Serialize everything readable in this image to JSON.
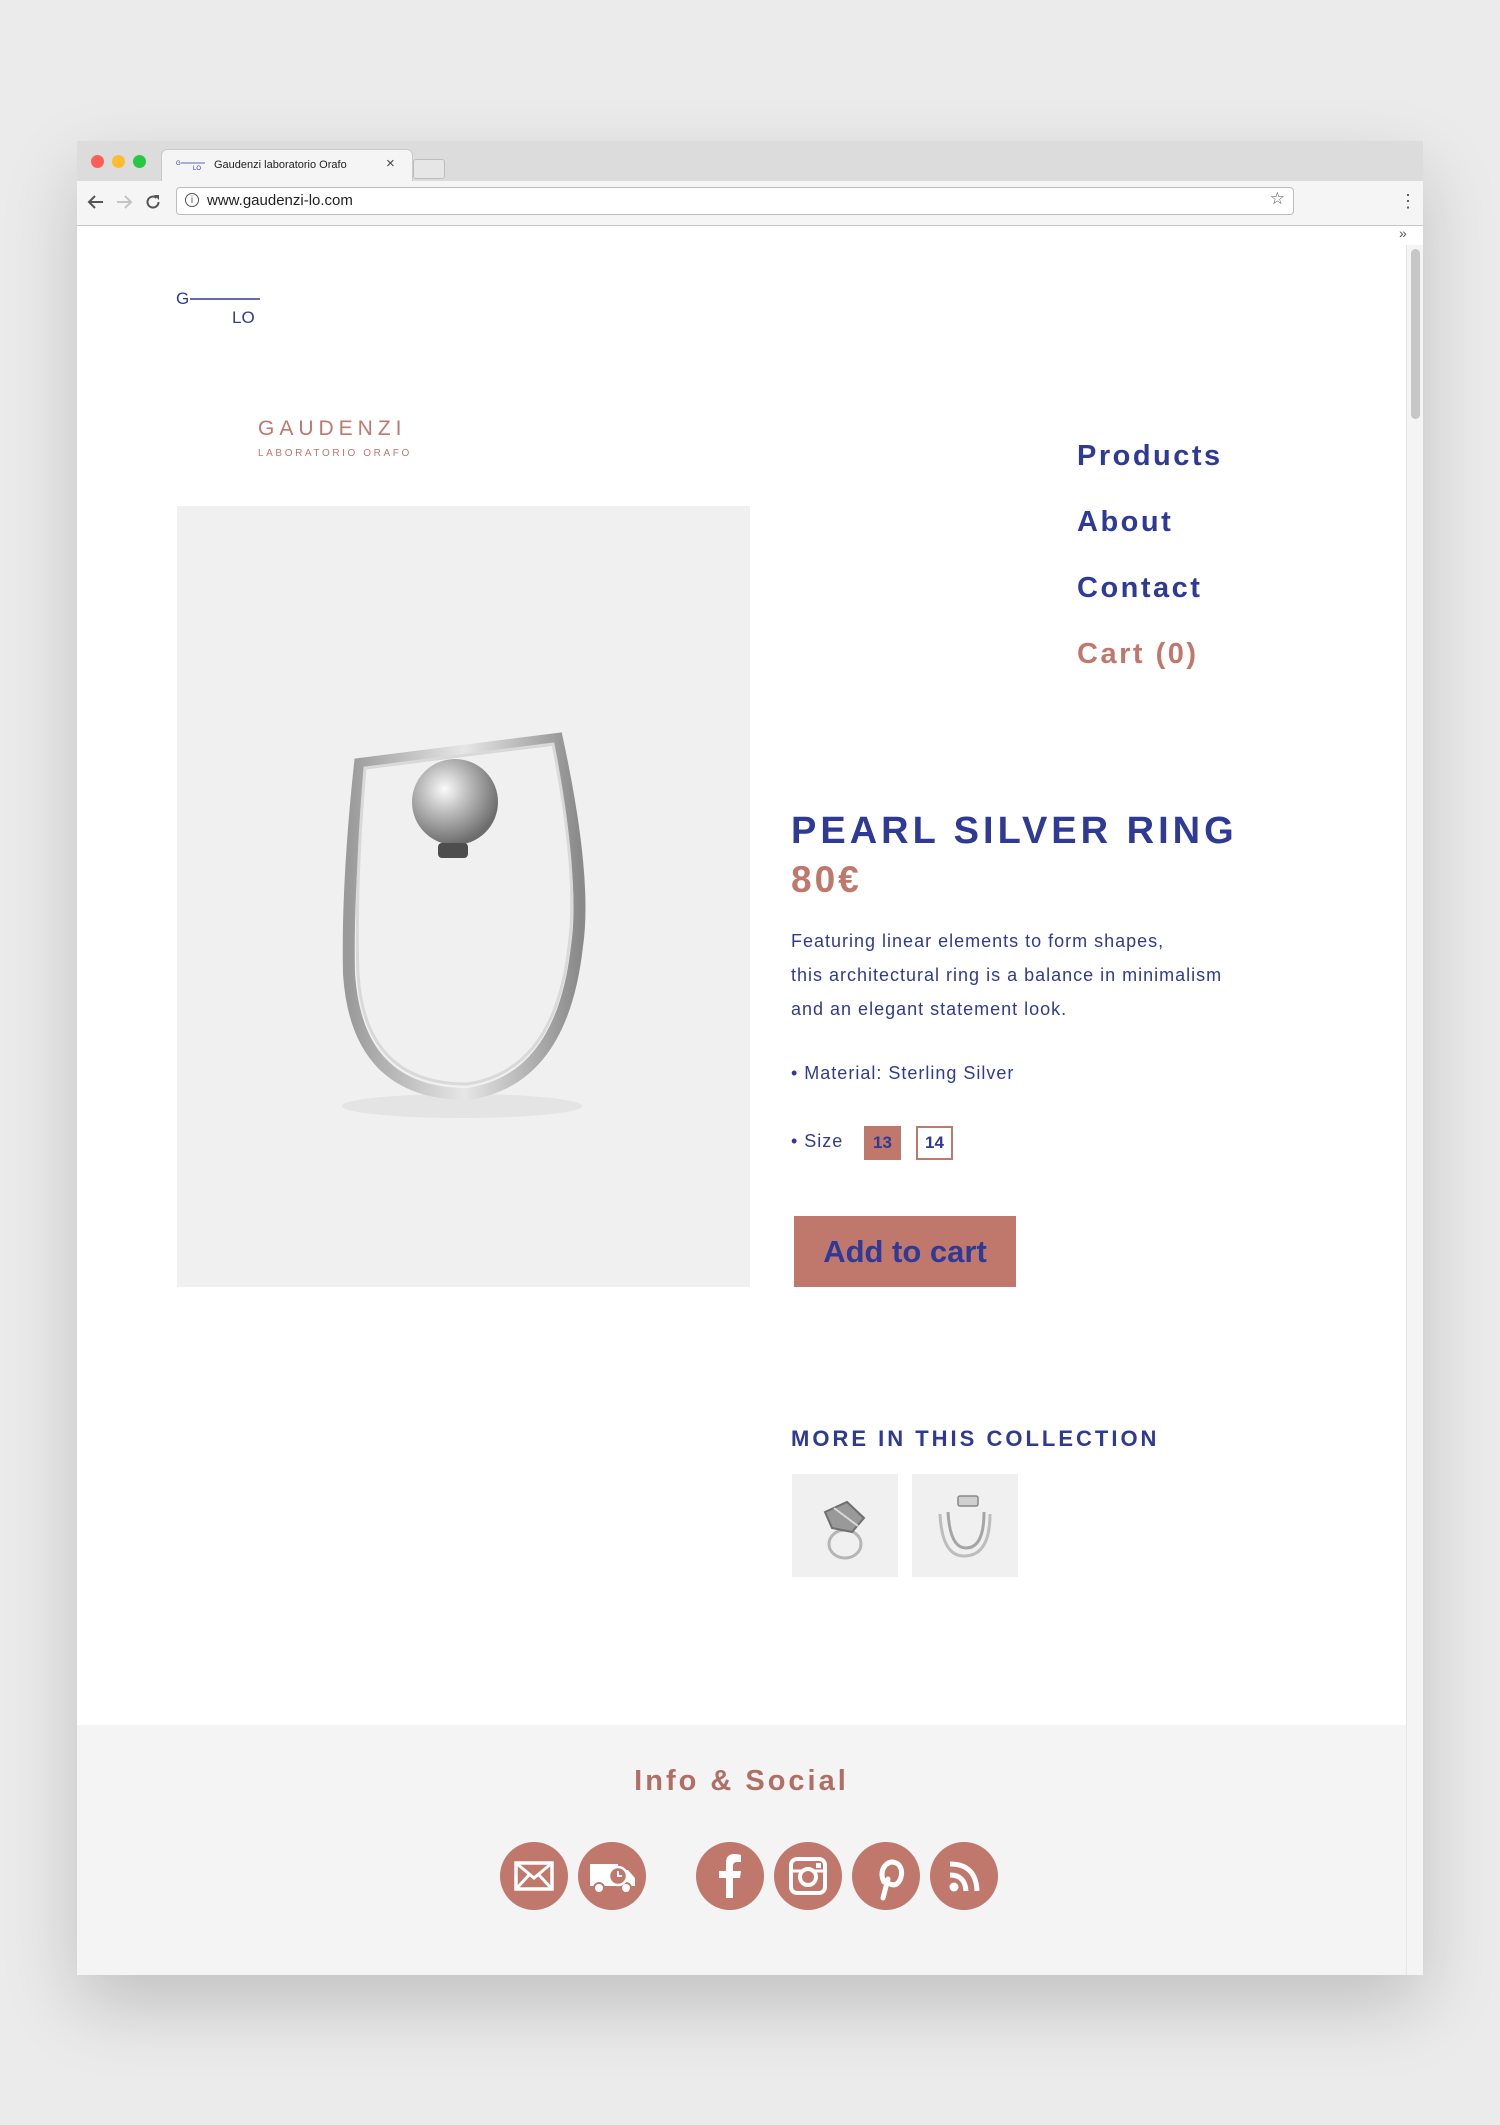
{
  "browser": {
    "tab_title": "Gaudenzi laboratorio Orafo",
    "url": "www.gaudenzi-lo.com",
    "tab_close": "×",
    "ext_label": "»"
  },
  "site": {
    "logo_g": "G",
    "logo_lo": "LO",
    "brand_name": "GAUDENZI",
    "brand_sub": "LABORATORIO ORAFO"
  },
  "nav": {
    "items": [
      {
        "label": "Products"
      },
      {
        "label": "About"
      },
      {
        "label": "Contact"
      },
      {
        "label": "Cart (0)"
      }
    ]
  },
  "product": {
    "title": "PEARL SILVER RING",
    "price": "80€",
    "description": [
      "Featuring linear elements to form shapes,",
      "this architectural ring is a balance in minimalism",
      "and an elegant statement look."
    ],
    "material": "• Material: Sterling Silver",
    "size_label": "• Size",
    "sizes": [
      "13",
      "14"
    ],
    "selected_size": "13",
    "add_to_cart_label": "Add to cart"
  },
  "collection": {
    "title": "MORE IN THIS COLLECTION"
  },
  "footer": {
    "title": "Info & Social",
    "icons": [
      "mail-icon",
      "delivery-truck-icon",
      "facebook-icon",
      "instagram-icon",
      "pinterest-icon",
      "rss-icon"
    ]
  },
  "colors": {
    "navy": "#2f3a96",
    "rose": "#c0776c",
    "image_bg": "#f0f0f0",
    "footer_bg": "#f4f4f4"
  }
}
